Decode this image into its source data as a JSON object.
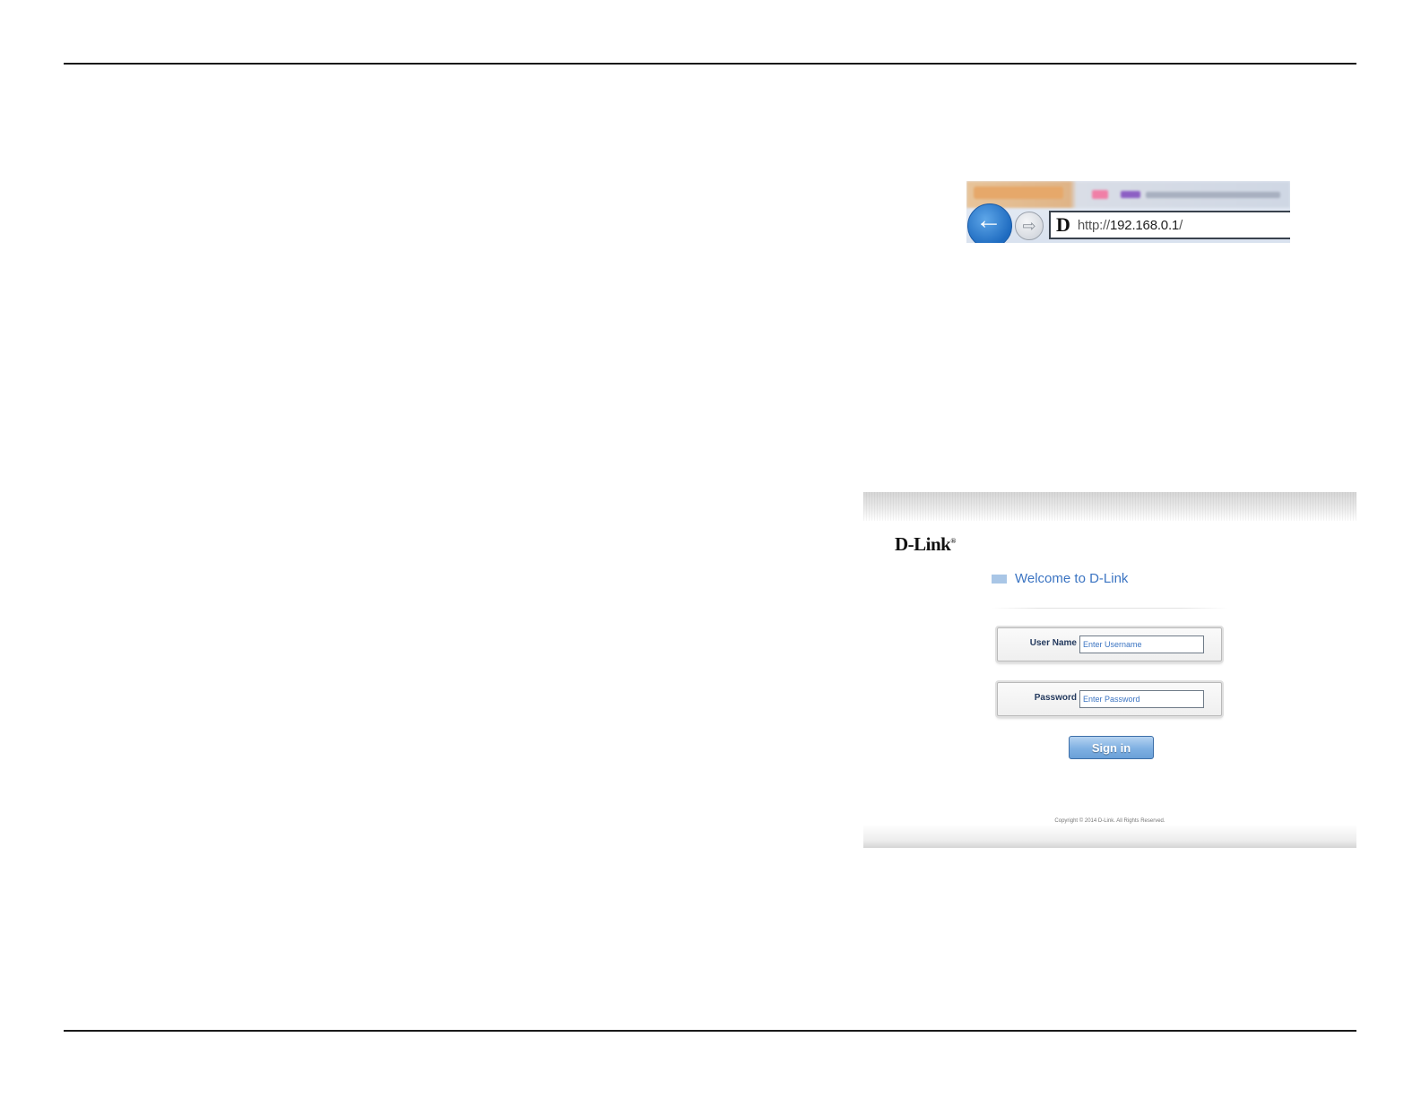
{
  "browser": {
    "favicon_letter": "D",
    "url_prefix": "http://",
    "url_host": "192.168.0.1",
    "url_suffix": "/",
    "back_glyph": "←",
    "forward_glyph": "⇨"
  },
  "login": {
    "logo_text": "D-Link",
    "logo_mark": "®",
    "welcome": "Welcome to D-Link",
    "username_label": "User Name",
    "username_placeholder": "Enter Username",
    "password_label": "Password",
    "password_placeholder": "Enter Password",
    "signin_label": "Sign in",
    "copyright": "Copyright © 2014 D-Link. All Rights Reserved."
  },
  "colors": {
    "accent_blue": "#3b74c2",
    "button_blue": "#7fb0e2",
    "label_navy": "#243a5e"
  }
}
